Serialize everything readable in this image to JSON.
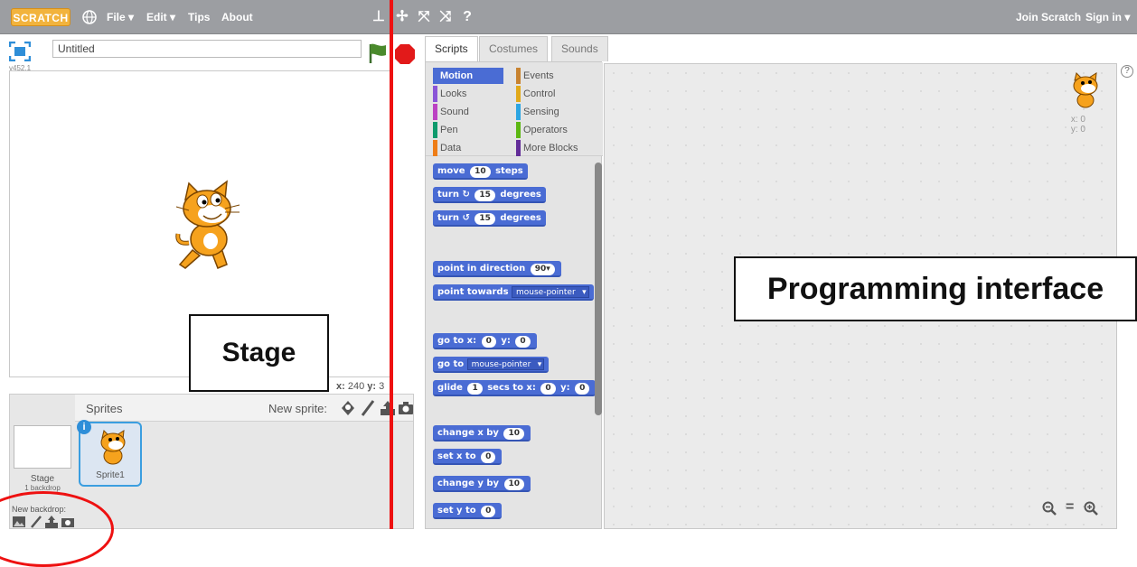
{
  "topbar": {
    "logo": "SCRATCH",
    "menu": [
      "File ▾",
      "Edit ▾",
      "Tips",
      "About"
    ],
    "join": "Join Scratch",
    "signin": "Sign in ▾"
  },
  "stage_header": {
    "project_title": "Untitled",
    "version": "v452.1"
  },
  "stage": {
    "coords_x_label": "x:",
    "coords_x": "240",
    "coords_y_label": "y:",
    "coords_y": "3"
  },
  "callouts": {
    "stage": "Stage",
    "programming": "Programming interface"
  },
  "sprites_panel": {
    "title": "Sprites",
    "new_sprite": "New sprite:",
    "stage_label": "Stage",
    "stage_backdrops": "1 backdrop",
    "sprite1": "Sprite1",
    "new_backdrop": "New backdrop:"
  },
  "tabs": [
    "Scripts",
    "Costumes",
    "Sounds"
  ],
  "categories": [
    {
      "label": "Motion",
      "color": "#4a6cd4",
      "selected": true
    },
    {
      "label": "Looks",
      "color": "#8a55d7"
    },
    {
      "label": "Sound",
      "color": "#bb42c3"
    },
    {
      "label": "Pen",
      "color": "#0e9a6c"
    },
    {
      "label": "Data",
      "color": "#ee7d16"
    },
    {
      "label": "Events",
      "color": "#c88330"
    },
    {
      "label": "Control",
      "color": "#e1a91a"
    },
    {
      "label": "Sensing",
      "color": "#2ca5e2"
    },
    {
      "label": "Operators",
      "color": "#5cb712"
    },
    {
      "label": "More Blocks",
      "color": "#632d99"
    }
  ],
  "blocks": {
    "move": {
      "pre": "move",
      "num": "10",
      "post": "steps"
    },
    "turn_cw": {
      "pre": "turn",
      "num": "15",
      "post": "degrees"
    },
    "turn_ccw": {
      "pre": "turn",
      "num": "15",
      "post": "degrees"
    },
    "point_dir": {
      "pre": "point in direction",
      "num": "90▾"
    },
    "point_towards": {
      "pre": "point towards",
      "drop": "mouse-pointer"
    },
    "goto_xy": {
      "pre": "go to x:",
      "x": "0",
      "mid": "y:",
      "y": "0"
    },
    "goto": {
      "pre": "go to",
      "drop": "mouse-pointer"
    },
    "glide": {
      "pre": "glide",
      "secs": "1",
      "mid": "secs to x:",
      "x": "0",
      "mid2": "y:",
      "y": "0"
    },
    "change_x": {
      "pre": "change x by",
      "num": "10"
    },
    "set_x": {
      "pre": "set x to",
      "num": "0"
    },
    "change_y": {
      "pre": "change y by",
      "num": "10"
    },
    "set_y": {
      "pre": "set y to",
      "num": "0"
    }
  },
  "scripts_area": {
    "x_label": "x: 0",
    "y_label": "y: 0",
    "help": "?",
    "zoom_out": "−",
    "zoom_reset": "=",
    "zoom_in": "+"
  }
}
